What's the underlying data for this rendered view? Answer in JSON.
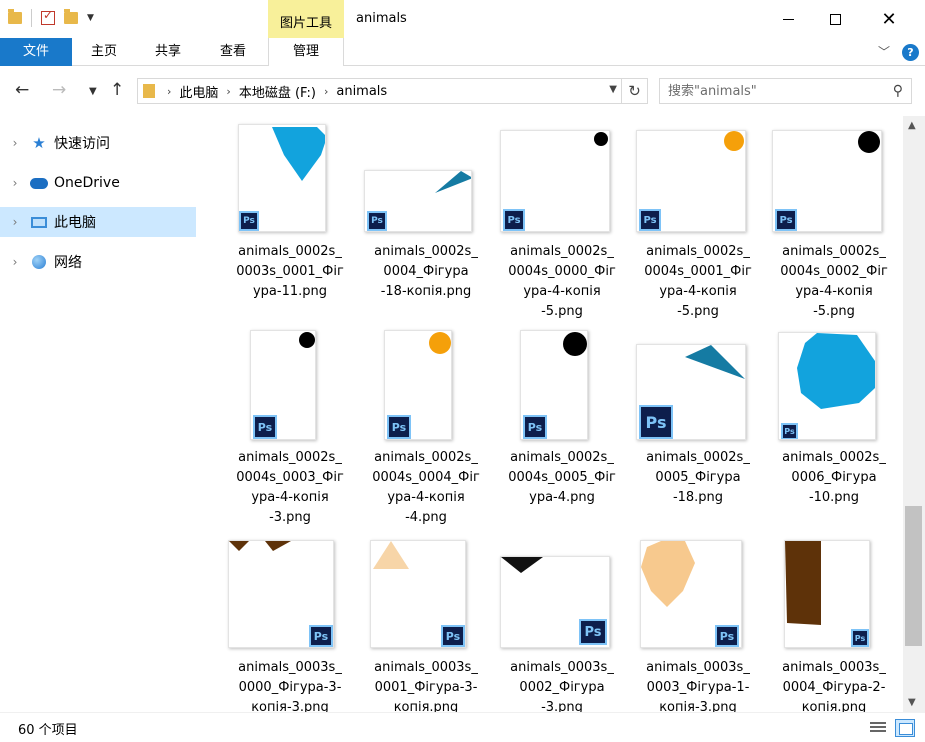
{
  "window": {
    "title": "animals",
    "tool_tab": "图片工具",
    "controls": {
      "minimize": "minimize",
      "maximize": "maximize",
      "close": "✕"
    }
  },
  "ribbon": {
    "tabs": [
      "文件",
      "主页",
      "共享",
      "查看",
      "管理"
    ],
    "help": "?"
  },
  "address": {
    "crumbs": [
      "此电脑",
      "本地磁盘 (F:)",
      "animals"
    ],
    "search_placeholder": "搜索\"animals\""
  },
  "sidebar": {
    "items": [
      {
        "label": "快速访问",
        "icon": "star-icon",
        "selected": false
      },
      {
        "label": "OneDrive",
        "icon": "cloud-icon",
        "selected": false
      },
      {
        "label": "此电脑",
        "icon": "computer-icon",
        "selected": true
      },
      {
        "label": "网络",
        "icon": "network-icon",
        "selected": false
      }
    ]
  },
  "files": [
    {
      "name": "animals_0002s_\n0003s_0001_Фіг\nура-11.png",
      "shape": "shield-blue"
    },
    {
      "name": "animals_0002s_\n0004_Фігура\n-18-копія.png",
      "shape": "wedge-teal-small"
    },
    {
      "name": "animals_0002s_\n0004s_0000_Фіг\nура-4-копія\n-5.png",
      "shape": "dot-black-small"
    },
    {
      "name": "animals_0002s_\n0004s_0001_Фіг\nура-4-копія\n-5.png",
      "shape": "dot-orange"
    },
    {
      "name": "animals_0002s_\n0004s_0002_Фіг\nура-4-копія\n-5.png",
      "shape": "dot-black-large"
    },
    {
      "name": "animals_0002s_\n0004s_0003_Фіг\nура-4-копія\n-3.png",
      "shape": "dot-black-tall"
    },
    {
      "name": "animals_0002s_\n0004s_0004_Фіг\nура-4-копія\n-4.png",
      "shape": "dot-orange-tall"
    },
    {
      "name": "animals_0002s_\n0004s_0005_Фіг\nура-4.png",
      "shape": "dot-black-tall-large"
    },
    {
      "name": "animals_0002s_\n0005_Фігура\n-18.png",
      "shape": "wedge-teal-large"
    },
    {
      "name": "animals_0002s_\n0006_Фігура\n-10.png",
      "shape": "octagon-blue"
    },
    {
      "name": "animals_0003s_\n0000_Фігура-3-\nкопія-3.png",
      "shape": "ears-brown"
    },
    {
      "name": "animals_0003s_\n0001_Фігура-3-\nкопія.png",
      "shape": "triangle-peach"
    },
    {
      "name": "animals_0003s_\n0002_Фігура\n-3.png",
      "shape": "triangle-black"
    },
    {
      "name": "animals_0003s_\n0003_Фігура-1-\nкопія-3.png",
      "shape": "hexagon-peach"
    },
    {
      "name": "animals_0003s_\n0004_Фігура-2-\nкопія.png",
      "shape": "rect-brown"
    }
  ],
  "ps_badge": "Ps",
  "status": {
    "count": "60 个项目"
  },
  "colors": {
    "accent": "#1979ca",
    "selection": "#cce8ff",
    "tool_tab": "#f8f09a",
    "blue_shape": "#12a3dd",
    "teal_shape": "#157ba3",
    "orange_shape": "#f5a00a",
    "peach_shape": "#f7c98e",
    "brown_shape": "#5e3209"
  }
}
